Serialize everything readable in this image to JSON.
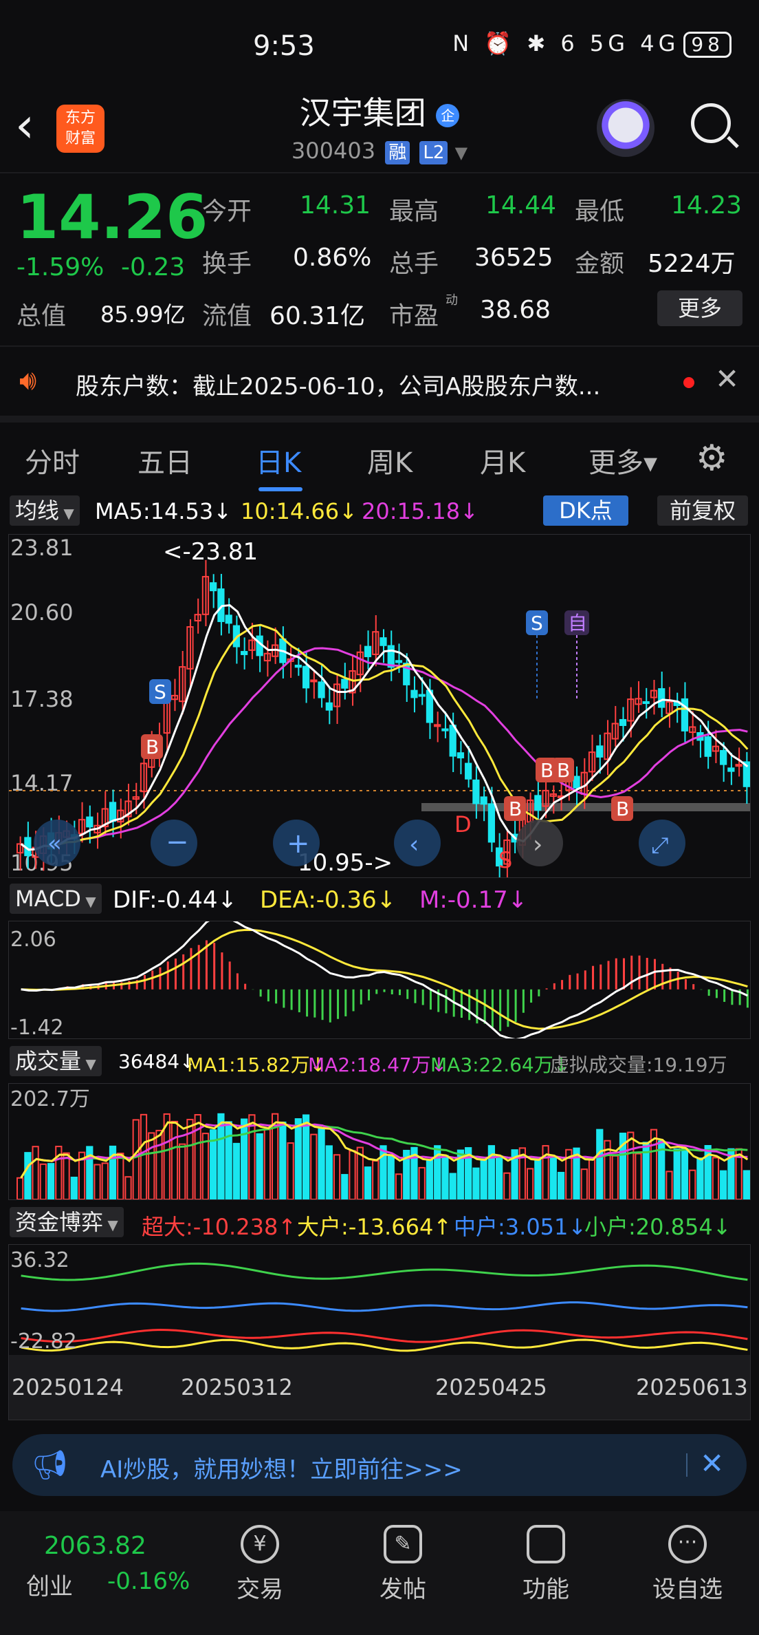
{
  "status_bar": {
    "time": "9:53",
    "icons": "N ⏰ ✱ 6 5G 4G",
    "battery": "98"
  },
  "header": {
    "stock_name": "汉宇集团",
    "badge": "企",
    "code": "300403",
    "tag_margin": "融",
    "tag_level": "L2",
    "logo_line1": "东方",
    "logo_line2": "财富"
  },
  "quote": {
    "price": "14.26",
    "change_pct": "-1.59%",
    "change": "-0.23",
    "open_label": "今开",
    "open": "14.31",
    "high_label": "最高",
    "high": "14.44",
    "low_label": "最低",
    "low": "14.23",
    "turnover_label": "换手",
    "turnover": "0.86%",
    "volume_label": "总手",
    "volume": "36525",
    "amount_label": "金额",
    "amount": "5224万",
    "mcap_label": "总值",
    "mcap": "85.99亿",
    "float_label": "流值",
    "float_cap": "60.31亿",
    "pe_label": "市盈",
    "pe_sup": "动",
    "pe": "38.68",
    "more_button": "更多"
  },
  "notice": {
    "text": "股东户数：截止2025-06-10，公司A股股东户数..."
  },
  "tabs": [
    {
      "label": "分时"
    },
    {
      "label": "五日"
    },
    {
      "label": "日K"
    },
    {
      "label": "周K"
    },
    {
      "label": "月K"
    },
    {
      "label": "更多▾"
    }
  ],
  "ma_bar": {
    "dropdown": "均线",
    "ma5": "MA5:14.53↓",
    "ma10": "10:14.66↓",
    "ma20": "20:15.18↓",
    "dk_button": "DK点",
    "adjust_button": "前复权"
  },
  "kline": {
    "y_labels": [
      "23.81",
      "20.60",
      "17.38",
      "14.17",
      "10.95"
    ],
    "max_label": "<-23.81",
    "min_label": "10.95->",
    "markers": [
      "S",
      "B",
      "B",
      "B",
      "B",
      "B",
      "S",
      "自",
      "D",
      "S"
    ]
  },
  "macd_bar": {
    "dropdown": "MACD",
    "dif": "DIF:-0.44↓",
    "dea": "DEA:-0.36↓",
    "m": "M:-0.17↓"
  },
  "macd": {
    "y_labels": [
      "2.06",
      "-1.42"
    ]
  },
  "vol_bar": {
    "dropdown": "成交量",
    "vol": "36484↓",
    "ma1": "MA1:15.82万↓",
    "ma2": "MA2:18.47万↓",
    "ma3": "MA3:22.64万↓",
    "virtual": "虚拟成交量:19.19万"
  },
  "vol": {
    "y_label": "202.7万"
  },
  "fund_bar": {
    "dropdown": "资金博弈",
    "super": "超大:-10.238↑",
    "big": "大户:-13.664↑",
    "mid": "中户:3.051↓",
    "small": "小户:20.854↓"
  },
  "fund": {
    "y_labels": [
      "36.32",
      "-22.82"
    ]
  },
  "dates": [
    "20250124",
    "20250312",
    "20250425",
    "20250613"
  ],
  "ad": {
    "text": "AI炒股，就用妙想！立即前往>>>"
  },
  "bottom_nav": {
    "index_value": "2063.82",
    "index_name": "创业",
    "index_change": "-0.16%",
    "items": [
      {
        "label": "交易"
      },
      {
        "label": "发帖"
      },
      {
        "label": "功能"
      },
      {
        "label": "设自选"
      }
    ]
  },
  "colors": {
    "up": "#ff4040",
    "down": "#1ec84a",
    "cyan": "#19e6ef",
    "accent": "#3d8bff",
    "ma5": "#ffffff",
    "ma10": "#ffe93b",
    "ma20": "#e23fe0"
  }
}
